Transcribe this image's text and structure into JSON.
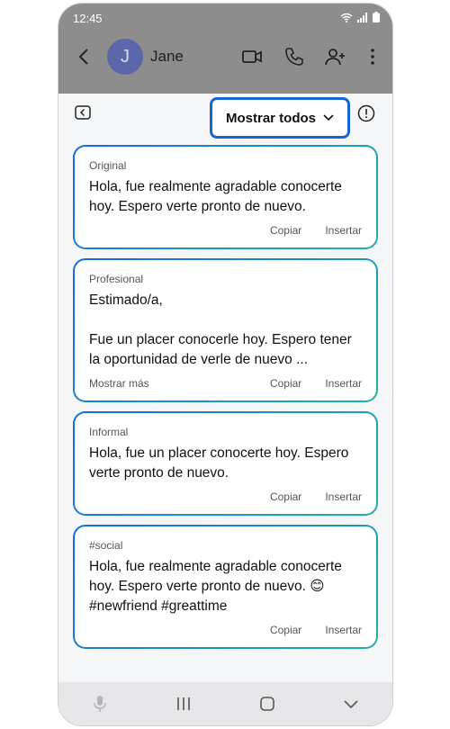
{
  "status": {
    "time": "12:45"
  },
  "header": {
    "contact_name": "Jane",
    "avatar_letter": "J"
  },
  "panel": {
    "dropdown_label": "Mostrar todos"
  },
  "cards": [
    {
      "label": "Original",
      "text": "Hola, fue realmente agradable conocerte hoy. Espero verte pronto de nuevo.",
      "show_more": "",
      "copy": "Copiar",
      "insert": "Insertar"
    },
    {
      "label": "Profesional",
      "text": "Estimado/a,\n\nFue un placer conocerle hoy. Espero tener la oportunidad de verle de nuevo ...",
      "show_more": "Mostrar más",
      "copy": "Copiar",
      "insert": "Insertar"
    },
    {
      "label": "Informal",
      "text": "Hola, fue un placer conocerte hoy. Espero verte pronto de nuevo.",
      "show_more": "",
      "copy": "Copiar",
      "insert": "Insertar"
    },
    {
      "label": "#social",
      "text": "Hola, fue realmente agradable conocerte hoy. Espero verte pronto de nuevo. 😊 #newfriend #greattime",
      "show_more": "",
      "copy": "Copiar",
      "insert": "Insertar"
    }
  ],
  "icons": {
    "accent": "#1864d6",
    "gradient_end": "#1fb3a5"
  }
}
